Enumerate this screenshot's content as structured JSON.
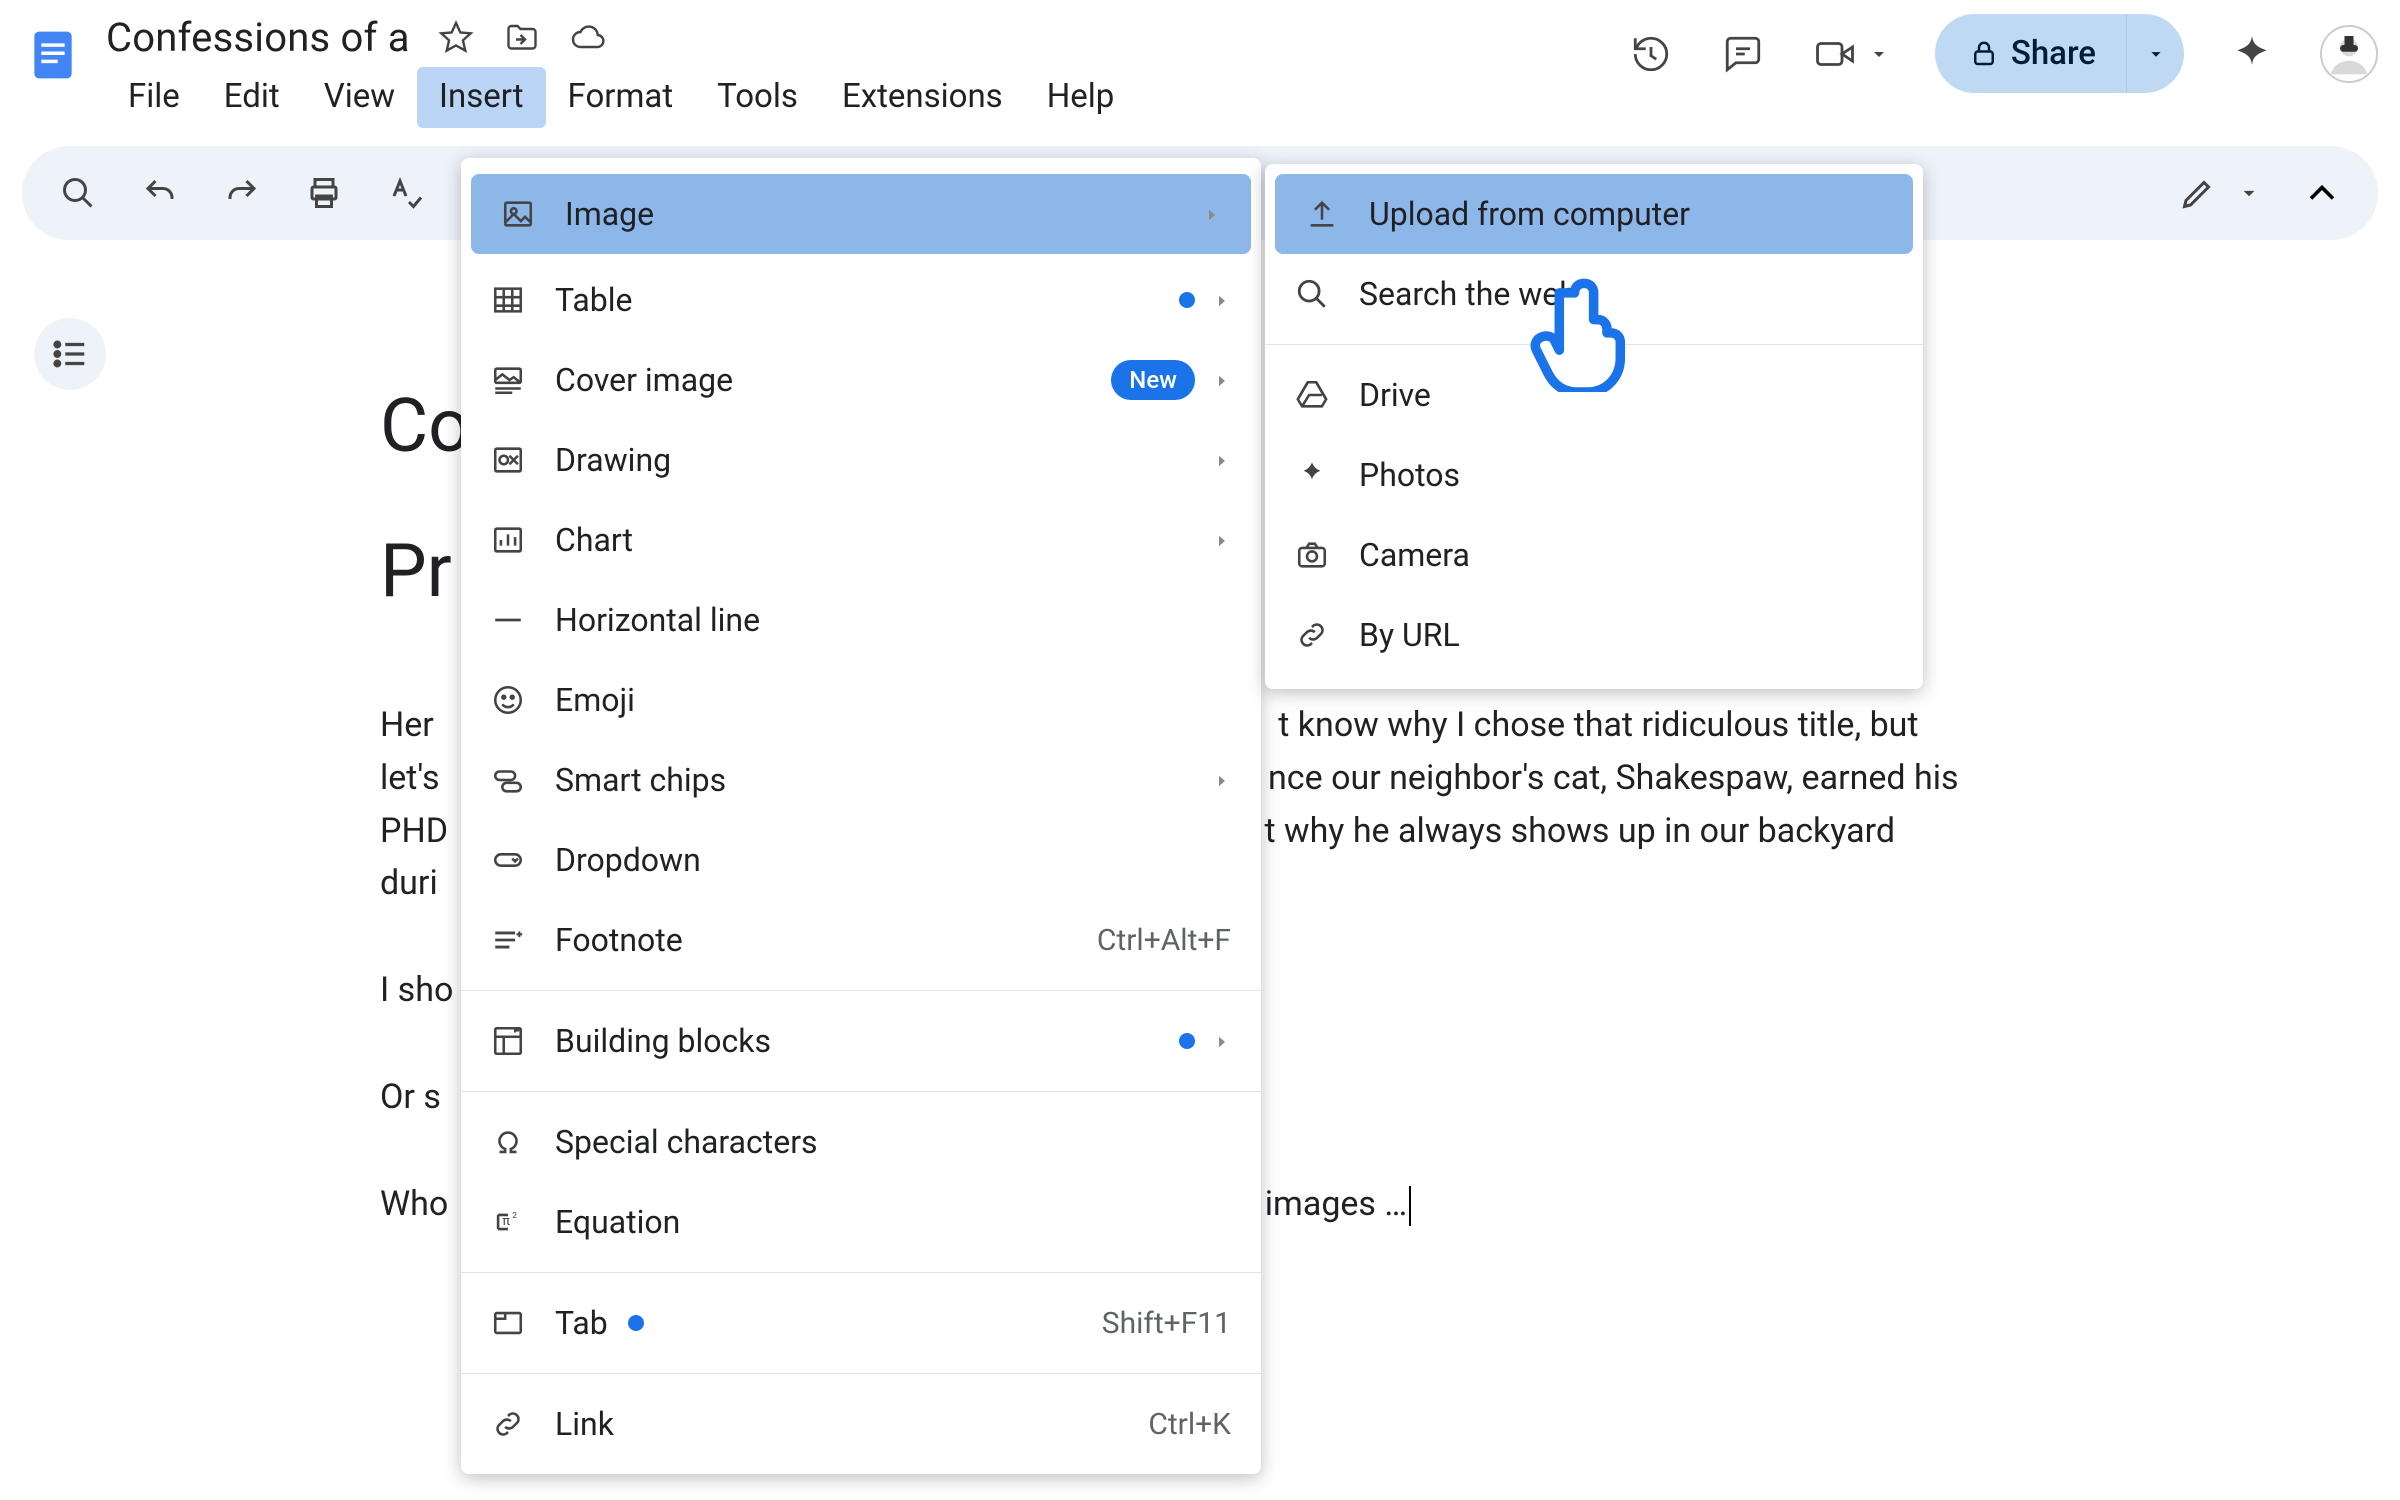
{
  "header": {
    "doc_title": "Confessions of a",
    "menus": [
      "File",
      "Edit",
      "View",
      "Insert",
      "Format",
      "Tools",
      "Extensions",
      "Help"
    ],
    "active_menu_index": 3,
    "share_label": "Share"
  },
  "insert_menu": {
    "items": [
      {
        "label": "Image",
        "has_submenu": true,
        "highlighted": true,
        "icon": "image"
      },
      {
        "label": "Table",
        "has_submenu": true,
        "dot": true,
        "icon": "table"
      },
      {
        "label": "Cover image",
        "has_submenu": true,
        "badge": "New",
        "icon": "cover"
      },
      {
        "label": "Drawing",
        "has_submenu": true,
        "icon": "drawing"
      },
      {
        "label": "Chart",
        "has_submenu": true,
        "icon": "chart"
      },
      {
        "label": "Horizontal line",
        "icon": "hline"
      },
      {
        "label": "Emoji",
        "icon": "emoji"
      },
      {
        "label": "Smart chips",
        "has_submenu": true,
        "icon": "chips"
      },
      {
        "label": "Dropdown",
        "icon": "dropdown"
      },
      {
        "label": "Footnote",
        "shortcut": "Ctrl+Alt+F",
        "icon": "footnote"
      },
      {
        "divider": true
      },
      {
        "label": "Building blocks",
        "has_submenu": true,
        "dot": true,
        "icon": "blocks"
      },
      {
        "divider": true
      },
      {
        "label": "Special characters",
        "icon": "omega"
      },
      {
        "label": "Equation",
        "icon": "equation"
      },
      {
        "divider": true
      },
      {
        "label": "Tab",
        "dot": true,
        "shortcut": "Shift+F11",
        "icon": "tab"
      },
      {
        "divider": true
      },
      {
        "label": "Link",
        "shortcut": "Ctrl+K",
        "icon": "link"
      }
    ]
  },
  "image_submenu": {
    "items": [
      {
        "label": "Upload from computer",
        "highlighted": true,
        "icon": "upload"
      },
      {
        "label": "Search the web",
        "icon": "search"
      },
      {
        "divider": true
      },
      {
        "label": "Drive",
        "icon": "drive"
      },
      {
        "label": "Photos",
        "icon": "photos"
      },
      {
        "label": "Camera",
        "icon": "camera"
      },
      {
        "label": "By URL",
        "icon": "url"
      }
    ]
  },
  "document": {
    "heading_line1": "Co",
    "heading_line2": "Pr",
    "p1_prefix": "Her",
    "p1_mid1_frag": "t know why I chose that ridiculous title, but",
    "p2_prefix": "let's",
    "p2_mid_frag": "nce our neighbor's cat, Shakespaw, earned his",
    "p3_prefix": "PHD",
    "p3_mid_frag": "t why he always shows up in our backyard",
    "p4_prefix": "duri",
    "p5": "I sho",
    "p6": "Or s",
    "p7_prefix": "Who",
    "p7_frag": " images …"
  }
}
